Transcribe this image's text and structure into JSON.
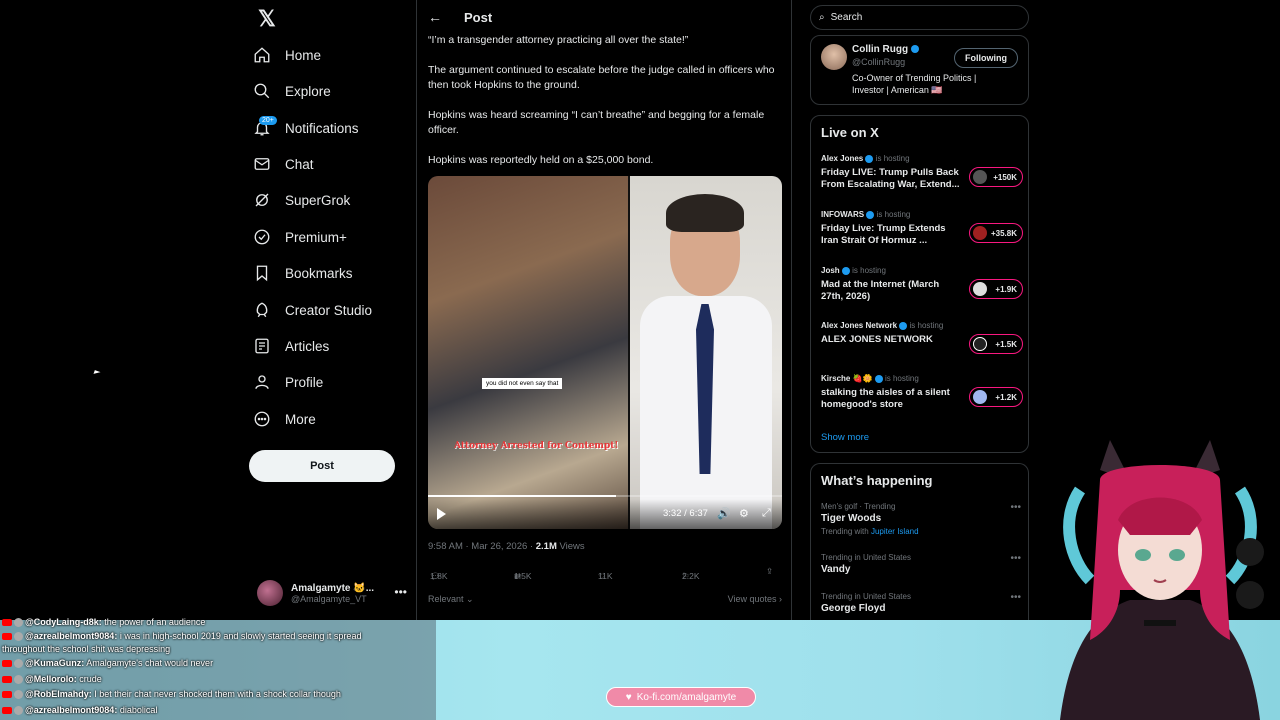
{
  "nav": {
    "items": [
      {
        "label": "Home",
        "icon": "home-icon"
      },
      {
        "label": "Explore",
        "icon": "search-icon"
      },
      {
        "label": "Notifications",
        "icon": "bell-icon",
        "badge": "20+"
      },
      {
        "label": "Chat",
        "icon": "mail-icon"
      },
      {
        "label": "SuperGrok",
        "icon": "grok-icon"
      },
      {
        "label": "Premium+",
        "icon": "premium-icon"
      },
      {
        "label": "Bookmarks",
        "icon": "bookmark-icon"
      },
      {
        "label": "Creator Studio",
        "icon": "rocket-icon"
      },
      {
        "label": "Articles",
        "icon": "article-icon"
      },
      {
        "label": "Profile",
        "icon": "person-icon"
      },
      {
        "label": "More",
        "icon": "more-circle-icon"
      }
    ],
    "post_button": "Post",
    "account": {
      "name": "Amalgamyte 🐱...",
      "handle": "@Amalgamyte_VT"
    }
  },
  "post": {
    "header_title": "Post",
    "paragraphs": [
      "“I’m a transgender attorney practicing all over the state!”",
      "The argument continued to escalate before the judge called in officers who then took Hopkins to the ground.",
      "Hopkins was heard screaming “I can’t breathe” and begging for a female officer.",
      "Hopkins was reportedly held on a $25,000 bond."
    ],
    "video": {
      "caption_top": "you did not even say that",
      "caption_bottom": "Attorney Arrested for Contempt!",
      "time": "3:32 / 6:37",
      "progress": 0.53
    },
    "meta_time": "9:58 AM · Mar 26, 2026 · ",
    "meta_views": "2.1M",
    "meta_views_label": " Views",
    "actions": {
      "replies": "1.8K",
      "reposts": "1.5K",
      "likes": "11K",
      "bookmarks": "2.2K"
    },
    "relevant": "Relevant",
    "view_quotes": "View quotes"
  },
  "right": {
    "search_placeholder": "Search",
    "profile": {
      "name": "Collin Rugg",
      "handle": "@CollinRugg",
      "bio": "Co-Owner of Trending Politics | Investor | American 🇺🇸",
      "follow_label": "Following"
    },
    "live_title": "Live on X",
    "live": [
      {
        "host": "Alex Jones",
        "title": "Friday LIVE: Trump Pulls Back From Escalating War, Extend...",
        "count": "+150K"
      },
      {
        "host": "INFOWARS",
        "title": "Friday Live: Trump Extends Iran Strait Of Hormuz ...",
        "count": "+35.8K"
      },
      {
        "host": "Josh",
        "title": "Mad at the Internet (March 27th, 2026)",
        "count": "+1.9K"
      },
      {
        "host": "Alex Jones Network",
        "title": "ALEX JONES NETWORK",
        "count": "+1.5K"
      },
      {
        "host": "Kirsche 🍓🌼",
        "title": "stalking the aisles of a silent homegood's store",
        "count": "+1.2K"
      }
    ],
    "hosting_label": "is hosting",
    "show_more": "Show more",
    "happening_title": "What’s happening",
    "trends": [
      {
        "context": "Men's golf · Trending",
        "name": "Tiger Woods",
        "sub": "Trending with ",
        "sub_link": "Jupiter Island"
      },
      {
        "context": "Trending in United States",
        "name": "Vandy",
        "sub": "",
        "sub_link": ""
      },
      {
        "context": "Trending in United States",
        "name": "George Floyd",
        "sub": "",
        "sub_link": ""
      }
    ]
  },
  "overlay": {
    "chat": [
      {
        "user": "@CodyLaing-d8k:",
        "msg": " the power of an audience"
      },
      {
        "user": "@azrealbelmont9084:",
        "msg": " i was in high-school 2019 and slowly started seeing it spread"
      },
      {
        "user": "",
        "msg": "throughout the school shit was depressing"
      },
      {
        "user": "@KumaGunz:",
        "msg": " Amalgamyte's chat would never"
      },
      {
        "user": "@Mellorolo:",
        "msg": " crude"
      },
      {
        "user": "@RobElmahdy:",
        "msg": " I bet their chat never shocked them with a shock collar though"
      },
      {
        "user": "@azrealbelmont9084:",
        "msg": " diabolical"
      }
    ],
    "kofi": "Ko-fi.com/amalgamyte"
  },
  "colors": {
    "accent": "#1d9bf0",
    "live_pill": "#f91880",
    "background": "#000000",
    "overlay": "#a6e6ef"
  }
}
